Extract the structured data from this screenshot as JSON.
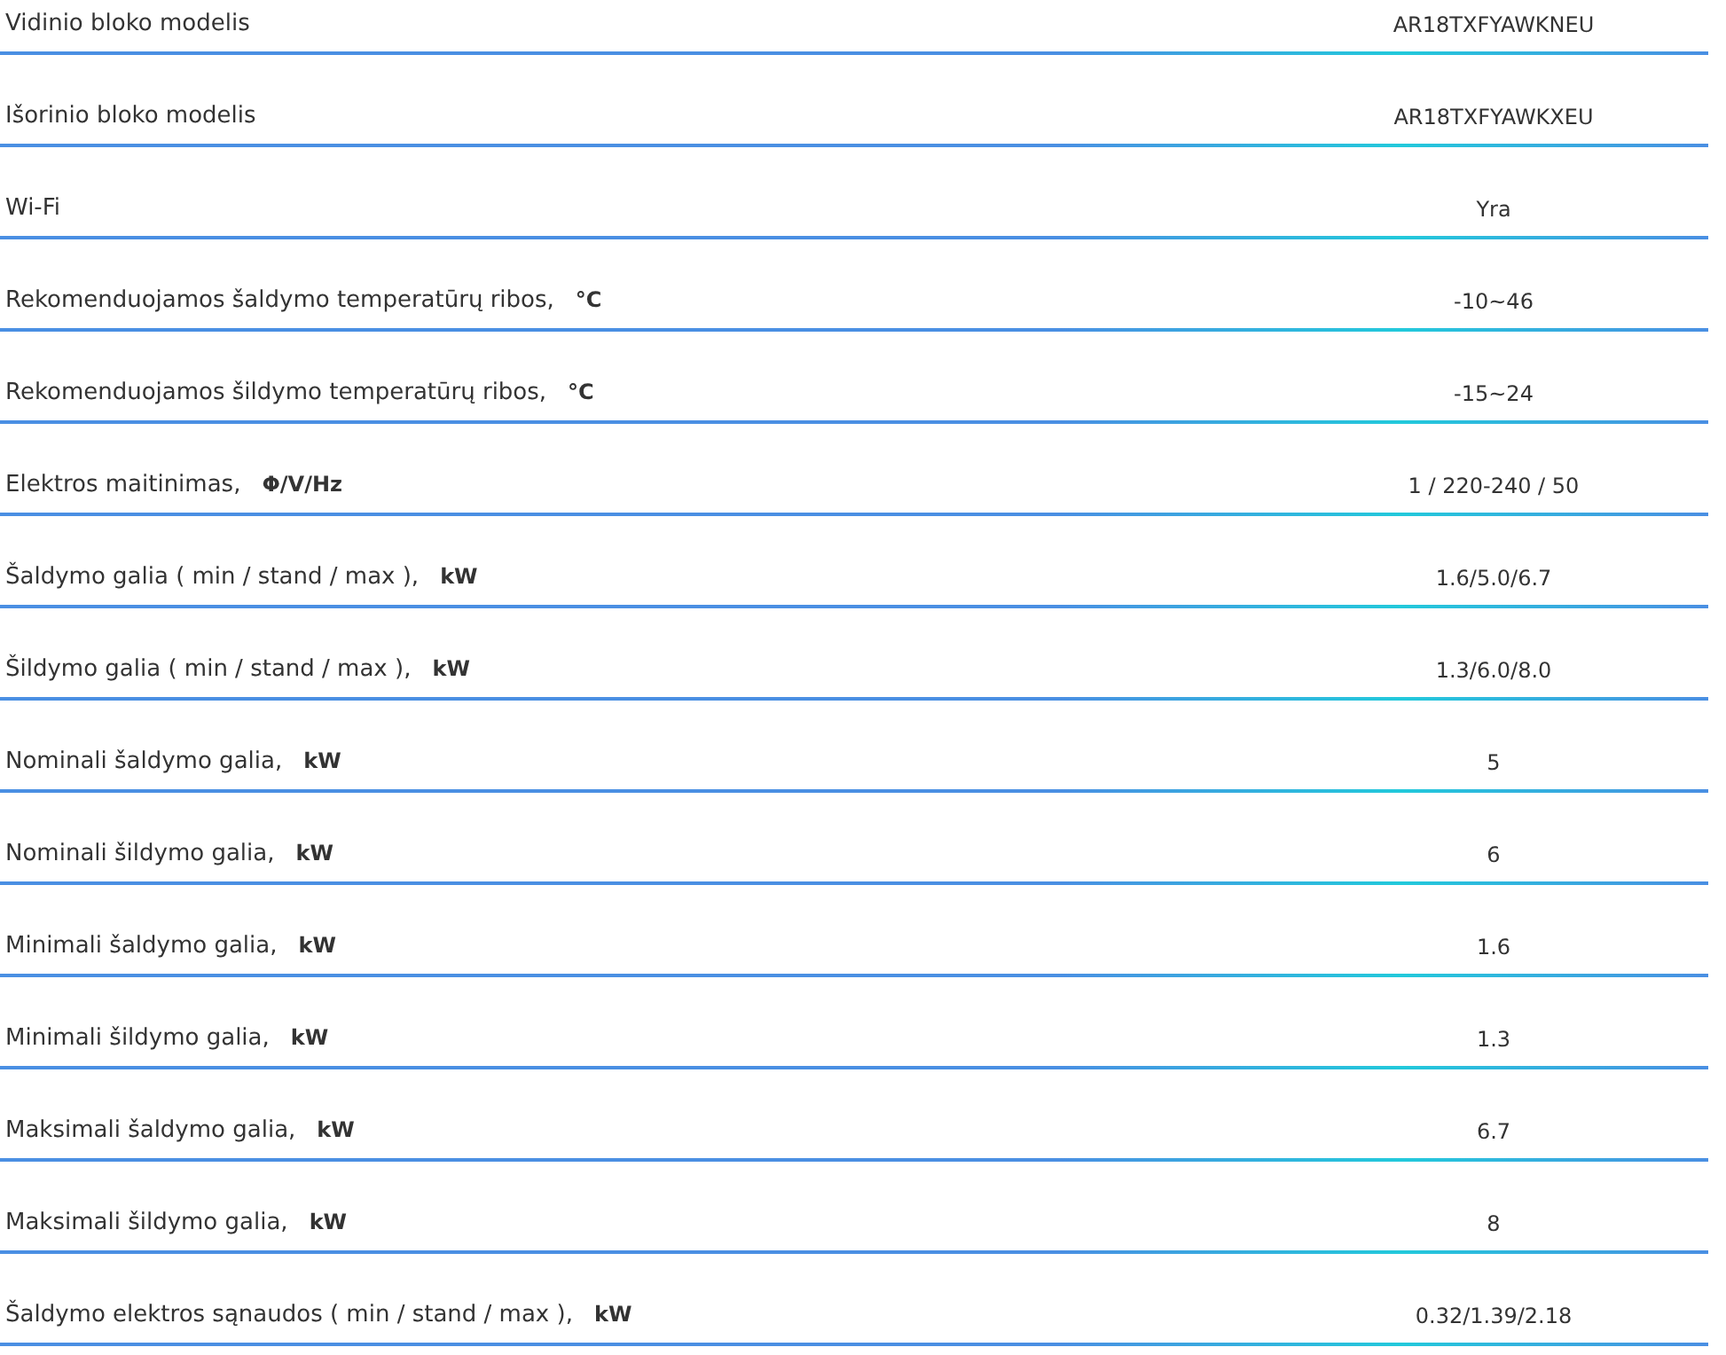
{
  "specs": [
    {
      "label": "Vidinio bloko modelis",
      "value": "AR18TXFYAWKNEU"
    },
    {
      "label": "Išorinio bloko modelis",
      "value": "AR18TXFYAWKXEU"
    },
    {
      "label": "Wi-Fi",
      "value": "Yra"
    },
    {
      "label": "Rekomenduojamos šaldymo temperatūrų ribos,",
      "unit": "°C",
      "value": "-10~46"
    },
    {
      "label": "Rekomenduojamos šildymo temperatūrų ribos,",
      "unit": "°C",
      "value": "-15~24"
    },
    {
      "label": "Elektros maitinimas,",
      "unit": "Φ/V/Hz",
      "value": "1 / 220-240 / 50"
    },
    {
      "label": "Šaldymo galia ( min / stand / max ),",
      "unit": "kW",
      "value": "1.6/5.0/6.7"
    },
    {
      "label": "Šildymo galia ( min / stand / max ),",
      "unit": "kW",
      "value": "1.3/6.0/8.0"
    },
    {
      "label": "Nominali šaldymo galia,",
      "unit": "kW",
      "value": "5"
    },
    {
      "label": "Nominali šildymo galia,",
      "unit": "kW",
      "value": "6"
    },
    {
      "label": "Minimali šaldymo galia,",
      "unit": "kW",
      "value": "1.6"
    },
    {
      "label": "Minimali šildymo galia,",
      "unit": "kW",
      "value": "1.3"
    },
    {
      "label": "Maksimali šaldymo galia,",
      "unit": "kW",
      "value": "6.7"
    },
    {
      "label": "Maksimali šildymo galia,",
      "unit": "kW",
      "value": "8"
    },
    {
      "label": "Šaldymo elektros sąnaudos ( min / stand / max ),",
      "unit": "kW",
      "value": "0.32/1.39/2.18"
    }
  ]
}
